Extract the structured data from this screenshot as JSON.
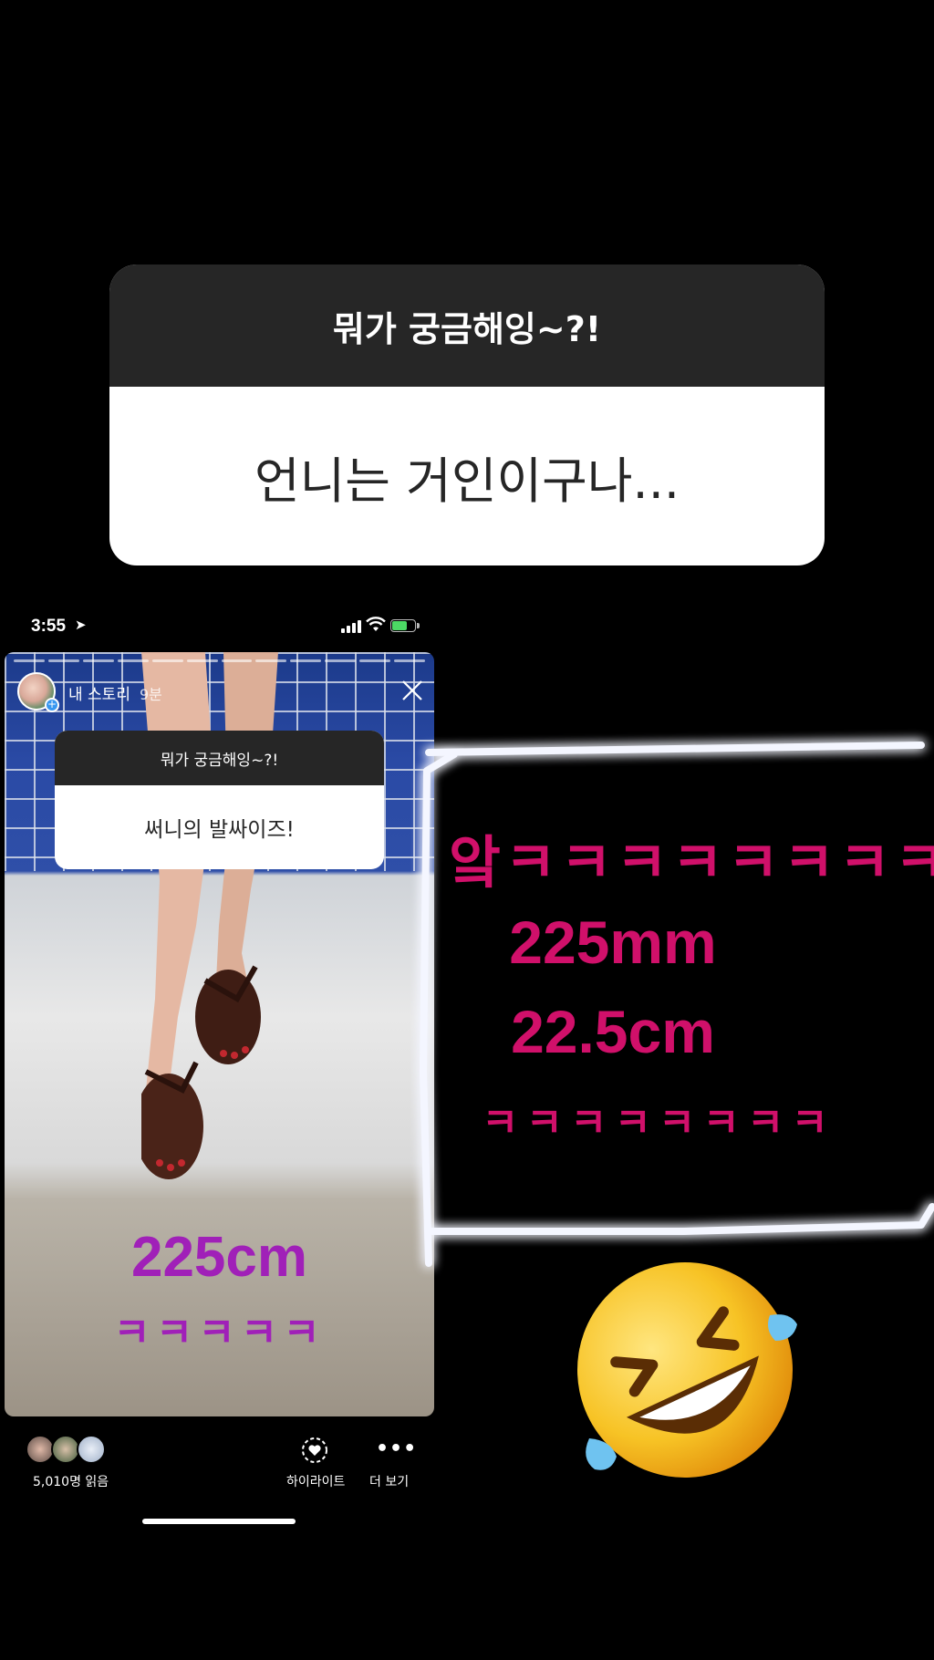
{
  "question_card": {
    "header": "뭐가 궁금해잉~?!",
    "answer": "언니는 거인이구나..."
  },
  "status_bar": {
    "time": "3:55",
    "location_arrow": "location-arrow-icon",
    "signal_icon": "cellular-signal-icon",
    "wifi_icon": "wifi-icon",
    "battery_icon": "battery-charging-icon"
  },
  "story": {
    "user": "내 스토리",
    "time_ago": "9분",
    "progress_segments": 12,
    "question_sticker": {
      "header": "뭐가 궁금해잉~?!",
      "answer": "써니의 발싸이즈!"
    },
    "overlay_big": "225cm",
    "overlay_small": "ㅋㅋㅋㅋㅋ"
  },
  "footer": {
    "views": "5,010명 읽음",
    "highlight_label": "하이라이트",
    "more_label": "더 보기",
    "more_glyph": "•••"
  },
  "annotation": {
    "line1": "앜ㅋㅋㅋㅋㅋㅋㅋㅋ",
    "line2": "225mm",
    "line3": "22.5cm",
    "line4": "ㅋㅋㅋㅋㅋㅋㅋㅋ",
    "emoji": "rolling-on-floor-laughing-emoji"
  },
  "colors": {
    "pink_text": "#d0106a",
    "purple_text": "#a020b8",
    "glow": "#dfe6ff"
  }
}
